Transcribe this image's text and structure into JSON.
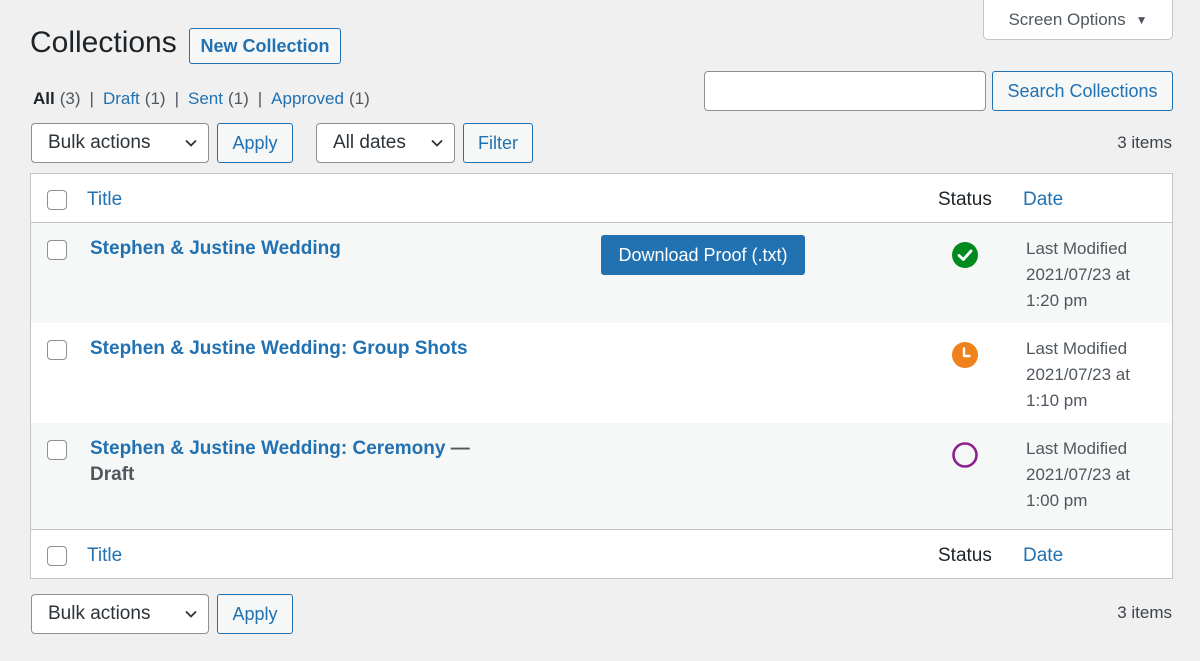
{
  "header": {
    "screen_options_label": "Screen Options",
    "page_title": "Collections",
    "new_button_label": "New Collection"
  },
  "filters": [
    {
      "label": "All",
      "count": "(3)",
      "current": true
    },
    {
      "label": "Draft",
      "count": "(1)",
      "current": false
    },
    {
      "label": "Sent",
      "count": "(1)",
      "current": false
    },
    {
      "label": "Approved",
      "count": "(1)",
      "current": false
    }
  ],
  "search": {
    "value": "",
    "button_label": "Search Collections"
  },
  "toolbar_top": {
    "bulk_actions_label": "Bulk actions",
    "apply_label": "Apply",
    "dates_label": "All dates",
    "filter_label": "Filter",
    "items_count": "3 items"
  },
  "table": {
    "columns": {
      "title": "Title",
      "status": "Status",
      "date": "Date"
    },
    "rows": [
      {
        "title": "Stephen & Justine Wedding",
        "state": "",
        "status_icon": "check-circle-icon",
        "status_color": "#008a20",
        "date_line1": "Last Modified",
        "date_line2": "2021/07/23 at",
        "date_line3": "1:20 pm",
        "action_label": "Download Proof (.txt)"
      },
      {
        "title": "Stephen & Justine Wedding: Group Shots",
        "state": "",
        "status_icon": "clock-icon",
        "status_color": "#f0821e",
        "date_line1": "Last Modified",
        "date_line2": "2021/07/23 at",
        "date_line3": "1:10 pm"
      },
      {
        "title": "Stephen & Justine Wedding: Ceremony",
        "dash": "—",
        "state": "Draft",
        "status_icon": "empty-circle-icon",
        "status_color": "#8e1e8e",
        "date_line1": "Last Modified",
        "date_line2": "2021/07/23 at",
        "date_line3": "1:00 pm"
      }
    ]
  },
  "toolbar_bottom": {
    "bulk_actions_label": "Bulk actions",
    "apply_label": "Apply",
    "items_count": "3 items"
  }
}
